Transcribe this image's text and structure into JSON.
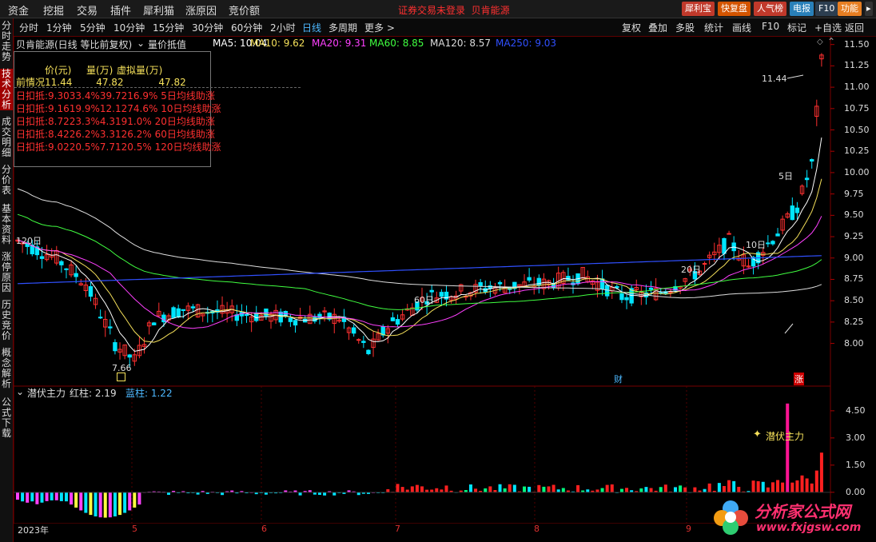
{
  "menu": {
    "items": [
      "资金",
      "挖掘",
      "交易",
      "插件",
      "犀利猫",
      "涨原因",
      "竞价额"
    ],
    "login_status": "证券交易未登录",
    "stock_name": "贝肯能源",
    "tool_buttons": [
      {
        "label": "犀利宝",
        "color": "#c0392b"
      },
      {
        "label": "快复盘",
        "color": "#d35400"
      },
      {
        "label": "人气榜",
        "color": "#c0392b"
      },
      {
        "label": "电报",
        "color": "#2980b9"
      },
      {
        "label": "F10",
        "color": "#2c3e50"
      },
      {
        "label": "功能",
        "color": "#e67e22"
      }
    ]
  },
  "periods": {
    "items": [
      "分时",
      "1分钟",
      "5分钟",
      "10分钟",
      "15分钟",
      "30分钟",
      "60分钟",
      "2小时",
      "日线",
      "多周期",
      "更多 >"
    ],
    "active": "日线",
    "right_tools": [
      "复权",
      "叠加",
      "多股",
      "统计",
      "画线",
      "F10",
      "标记",
      "+自选",
      "返回"
    ]
  },
  "left_tabs": [
    {
      "label": "分时走势",
      "active": false
    },
    {
      "label": "技术分析",
      "active": true
    },
    {
      "label": "成交明细",
      "active": false
    },
    {
      "label": "分价表",
      "active": false
    },
    {
      "label": "基本资料",
      "active": false
    },
    {
      "label": "涨停原因",
      "active": false
    },
    {
      "label": "历史竞价",
      "active": false
    },
    {
      "label": "概念解析",
      "active": false
    },
    {
      "label": "公式下载",
      "active": false
    }
  ],
  "main_legend": {
    "title": "贝肯能源(日线 等比前复权)",
    "indicator": "量价抵值",
    "ma": [
      {
        "label": "MA5: 10.04",
        "color": "#ffffff"
      },
      {
        "label": "MA10: 9.62",
        "color": "#f5e05a"
      },
      {
        "label": "MA20: 9.31",
        "color": "#ff40ff"
      },
      {
        "label": "MA60: 8.85",
        "color": "#40ff40"
      },
      {
        "label": "MA120: 8.57",
        "color": "#dddddd"
      },
      {
        "label": "MA250: 9.03",
        "color": "#3050ff"
      }
    ]
  },
  "info_box": {
    "headers": [
      "价(元)",
      "量(万)",
      "虚拟量(万)"
    ],
    "rows": [
      {
        "label": "前情况",
        "c1": "11.44",
        "c2": "47.82",
        "c3": "47.82",
        "note": ""
      },
      {
        "label": "日扣抵:",
        "c1": "9.30",
        "c2": "33.4%",
        "c3": "39.72",
        "c4": "16.9%",
        "note": "5日均线助涨"
      },
      {
        "label": "日扣抵:",
        "c1": "9.16",
        "c2": "19.9%",
        "c3": "12.12",
        "c4": "74.6%",
        "note": "10日均线助涨"
      },
      {
        "label": "日扣抵:",
        "c1": "8.72",
        "c2": "23.3%",
        "c3": "4.31",
        "c4": "91.0%",
        "note": "20日均线助涨"
      },
      {
        "label": "日扣抵:",
        "c1": "8.42",
        "c2": "26.2%",
        "c3": "3.31",
        "c4": "26.2%",
        "note": "60日均线助涨"
      },
      {
        "label": "日扣抵:",
        "c1": "9.02",
        "c2": "20.5%",
        "c3": "7.71",
        "c4": "20.5%",
        "note": "120日均线助涨"
      }
    ]
  },
  "price_axis": [
    "11.50",
    "11.25",
    "11.00",
    "10.75",
    "10.50",
    "10.25",
    "10.00",
    "9.75",
    "9.50",
    "9.25",
    "9.00",
    "8.75",
    "8.50",
    "8.25",
    "8.00"
  ],
  "chart_labels": {
    "high": "11.44",
    "low": "7.66",
    "ma_tags": [
      "120日",
      "60日",
      "20日",
      "10日",
      "5日"
    ],
    "markers": [
      "财",
      "涨"
    ]
  },
  "sub_legend": {
    "title": "潜伏主力",
    "red": "红柱: 2.19",
    "blue": "蓝柱: 1.22",
    "annotation": "潜伏主力"
  },
  "sub_axis": [
    "4.50",
    "3.00",
    "1.50",
    "0.00"
  ],
  "x_axis": [
    "2023年",
    "5",
    "6",
    "7",
    "8",
    "9"
  ],
  "watermark": "分析家公式网 fxjgsw.Com",
  "logo": {
    "text": "分析家公式网",
    "url": "www.fxjgsw.com"
  },
  "chart_data": {
    "type": "candlestick",
    "title": "贝肯能源(日线 等比前复权)",
    "ylim": [
      7.5,
      11.6
    ],
    "candles_approx": {
      "start_price": 9.2,
      "low": 7.66,
      "high": 11.44,
      "last_close": 10.4
    },
    "series": [
      {
        "name": "MA5",
        "last": 10.04
      },
      {
        "name": "MA10",
        "last": 9.62
      },
      {
        "name": "MA20",
        "last": 9.31
      },
      {
        "name": "MA60",
        "last": 8.85
      },
      {
        "name": "MA120",
        "last": 8.57
      },
      {
        "name": "MA250",
        "last": 9.03
      }
    ],
    "sub_chart": {
      "name": "潜伏主力",
      "red": 2.19,
      "blue": 1.22,
      "ylim": [
        -1.2,
        5.2
      ]
    }
  }
}
